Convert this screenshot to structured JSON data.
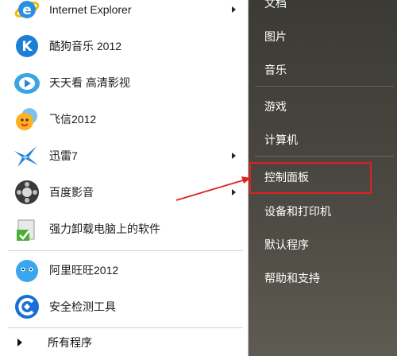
{
  "left_menu": {
    "items": [
      {
        "label": "Internet Explorer",
        "icon": "internet-explorer-icon",
        "has_submenu": true
      },
      {
        "label": "酷狗音乐 2012",
        "icon": "kugou-music-icon",
        "has_submenu": false
      },
      {
        "label": "天天看 高清影视",
        "icon": "tiantiankan-icon",
        "has_submenu": false
      },
      {
        "label": "飞信2012",
        "icon": "fetion-icon",
        "has_submenu": false
      },
      {
        "label": "迅雷7",
        "icon": "xunlei-icon",
        "has_submenu": true
      },
      {
        "label": "百度影音",
        "icon": "baidu-player-icon",
        "has_submenu": true
      },
      {
        "label": "强力卸载电脑上的软件",
        "icon": "uninstaller-icon",
        "has_submenu": false
      },
      {
        "label": "阿里旺旺2012",
        "icon": "aliwangwang-icon",
        "has_submenu": false
      },
      {
        "label": "安全检测工具",
        "icon": "security-check-icon",
        "has_submenu": false
      }
    ],
    "all_programs_label": "所有程序"
  },
  "right_menu": {
    "items": [
      {
        "label": "文档"
      },
      {
        "label": "图片"
      },
      {
        "label": "音乐"
      },
      {
        "label": "游戏"
      },
      {
        "label": "计算机"
      },
      {
        "label": "控制面板"
      },
      {
        "label": "设备和打印机"
      },
      {
        "label": "默认程序"
      },
      {
        "label": "帮助和支持"
      }
    ]
  },
  "annotation": {
    "highlight_color": "#e02020",
    "highlighted_item": "控制面板"
  },
  "colors": {
    "right_pane": "#45433c",
    "left_pane": "#ffffff"
  }
}
